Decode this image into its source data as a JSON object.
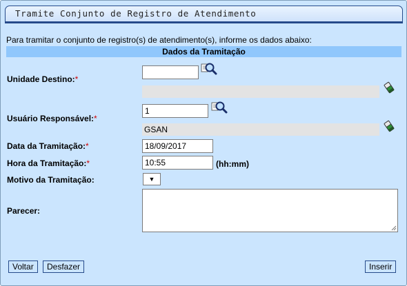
{
  "window": {
    "title": "Tramite Conjunto de Registro de Atendimento"
  },
  "intro_text": "Para tramitar o conjunto de registro(s) de atendimento(s), informe os dados abaixo:",
  "section_title": "Dados da Tramitação",
  "required_marker": "*",
  "fields": {
    "unidade_destino": {
      "label": "Unidade Destino:",
      "value": "",
      "description": ""
    },
    "usuario_responsavel": {
      "label": "Usuário Responsável:",
      "value": "1",
      "description": "GSAN"
    },
    "data_tramitacao": {
      "label": "Data da Tramitação:",
      "value": "18/09/2017"
    },
    "hora_tramitacao": {
      "label": "Hora da Tramitação:",
      "value": "10:55",
      "unit": "(hh:mm)"
    },
    "motivo_tramitacao": {
      "label": "Motivo da Tramitação:",
      "selected": "",
      "arrow": "▼"
    },
    "parecer": {
      "label": "Parecer:",
      "value": ""
    }
  },
  "buttons": {
    "voltar": "Voltar",
    "desfazer": "Desfazer",
    "inserir": "Inserir"
  },
  "icons": {
    "search": "magnifier-icon",
    "clear": "eraser-icon"
  },
  "colors": {
    "panel_bg": "#cbe5fe",
    "section_bar": "#90c7fc",
    "border_blue": "#254a8a",
    "required": "#d00000"
  }
}
